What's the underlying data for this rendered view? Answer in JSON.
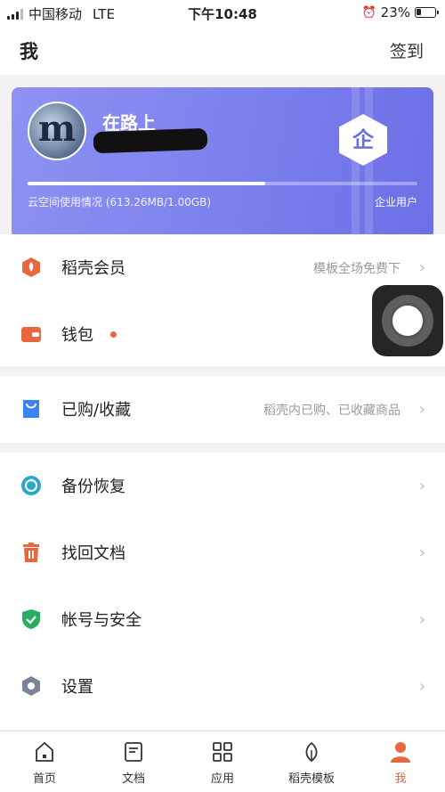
{
  "status_bar": {
    "carrier": "中国移动",
    "network": "LTE",
    "time": "下午10:48",
    "battery": "23%"
  },
  "nav": {
    "title": "我",
    "action": "签到"
  },
  "card": {
    "avatar_letter": "m",
    "username": "在路上",
    "storage_usage": "云空间使用情况 (613.26MB/1.00GB)",
    "storage_fraction": 0.61,
    "enterprise_badge": "企",
    "enterprise_label": "企业用户"
  },
  "rows": [
    {
      "label": "稻壳会员",
      "subtitle": "模板全场免费下",
      "icon": "docer-member-icon",
      "color": "#e8673f"
    },
    {
      "label": "钱包",
      "subtitle": "",
      "icon": "wallet-icon",
      "color": "#e8673f",
      "dot": true
    },
    {
      "label": "已购/收藏",
      "subtitle": "稻壳内已购、已收藏商品",
      "icon": "shopping-bag-icon",
      "color": "#3b82f6"
    },
    {
      "label": "备份恢复",
      "subtitle": "",
      "icon": "backup-icon",
      "color": "#2aa8c8"
    },
    {
      "label": "找回文档",
      "subtitle": "",
      "icon": "trash-icon",
      "color": "#e8673f"
    },
    {
      "label": "帐号与安全",
      "subtitle": "",
      "icon": "shield-icon",
      "color": "#27ae60"
    },
    {
      "label": "设置",
      "subtitle": "",
      "icon": "settings-icon",
      "color": "#7a8497"
    }
  ],
  "tabs": [
    {
      "label": "首页",
      "icon": "home-icon"
    },
    {
      "label": "文档",
      "icon": "document-icon"
    },
    {
      "label": "应用",
      "icon": "apps-grid-icon"
    },
    {
      "label": "稻壳模板",
      "icon": "leaf-icon"
    },
    {
      "label": "我",
      "icon": "profile-icon",
      "active": true
    }
  ],
  "chevron": "›",
  "colors": {
    "accent": "#e8673f",
    "card": "#7f83ee",
    "ent": "#6b6fe4"
  }
}
